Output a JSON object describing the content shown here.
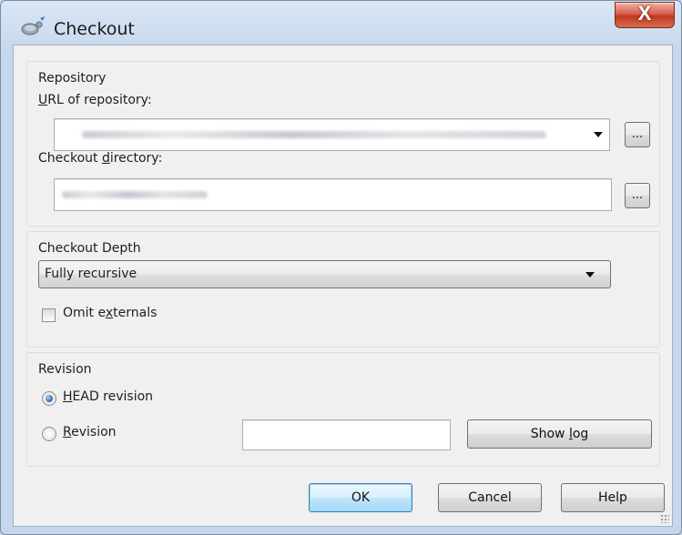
{
  "window": {
    "title": "Checkout",
    "close_glyph": "X"
  },
  "repository": {
    "group_title": "Repository",
    "url_label_pre": "",
    "url_label_mnemonic": "U",
    "url_label_post": "RL of repository:",
    "dir_label_pre": "Checkout ",
    "dir_label_mnemonic": "d",
    "dir_label_post": "irectory:",
    "browse_glyph": "..."
  },
  "depth": {
    "group_title": "Checkout Depth",
    "selected": "Fully recursive",
    "omit_pre": "Omit e",
    "omit_mnemonic": "x",
    "omit_post": "ternals",
    "omit_checked": false
  },
  "revision": {
    "group_title": "Revision",
    "head_pre": "",
    "head_mnemonic": "H",
    "head_post": "EAD revision",
    "head_selected": true,
    "rev_pre": "",
    "rev_mnemonic": "R",
    "rev_post": "evision",
    "rev_value": "",
    "show_log_pre": "Show ",
    "show_log_mnemonic": "l",
    "show_log_post": "og"
  },
  "buttons": {
    "ok": "OK",
    "cancel": "Cancel",
    "help": "Help"
  }
}
